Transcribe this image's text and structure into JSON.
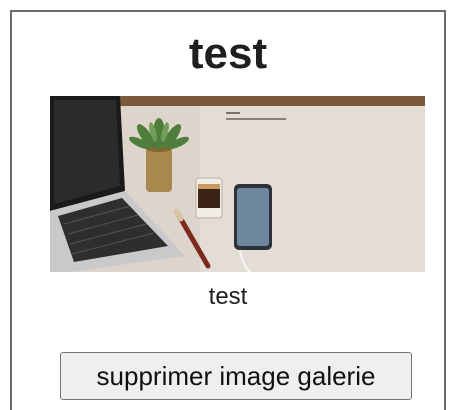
{
  "gallery_item": {
    "title": "test",
    "caption": "test",
    "image_alt_icon": "desk-photo-image"
  },
  "actions": {
    "delete_label": "supprimer image galerie"
  },
  "colors": {
    "border": "#6b6b6b",
    "button_bg": "#efefef",
    "button_border": "#767676",
    "text": "#1f1f1f"
  }
}
